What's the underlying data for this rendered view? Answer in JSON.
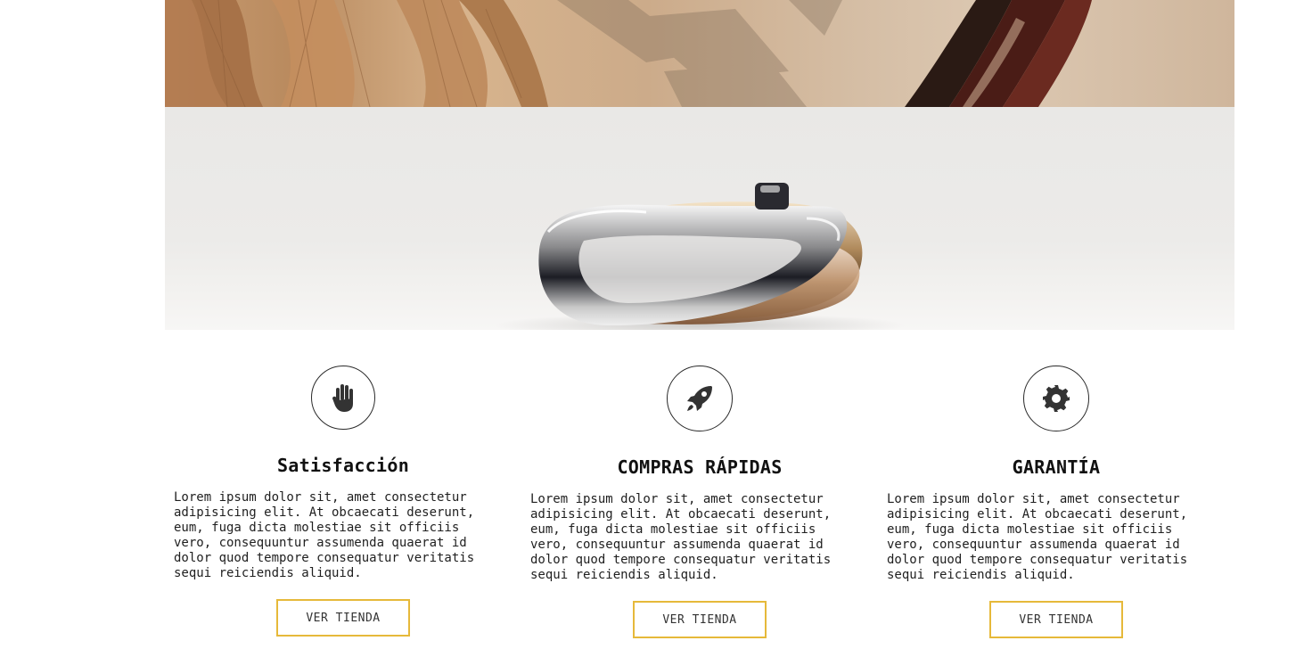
{
  "features": [
    {
      "icon": "hand-icon",
      "title": "Satisfacción",
      "body": "Lorem ipsum dolor sit, amet consectetur adipisicing elit. At obcaecati deserunt, eum, fuga dicta molestiae sit officiis vero, consequuntur assumenda quaerat id dolor quod tempore consequatur veritatis sequi reiciendis aliquid.",
      "button_label": "VER TIENDA"
    },
    {
      "icon": "rocket-icon",
      "title": "COMPRAS RÁPIDAS",
      "body": "Lorem ipsum dolor sit, amet consectetur adipisicing elit. At obcaecati deserunt, eum, fuga dicta molestiae sit officiis vero, consequuntur assumenda quaerat id dolor quod tempore consequatur veritatis sequi reiciendis aliquid.",
      "button_label": "VER TIENDA"
    },
    {
      "icon": "gear-icon",
      "title": "GARANTÍA",
      "body": "Lorem ipsum dolor sit, amet consectetur adipisicing elit. At obcaecati deserunt, eum, fuga dicta molestiae sit officiis vero, consequuntur assumenda quaerat id dolor quod tempore consequatur veritatis sequi reiciendis aliquid.",
      "button_label": "VER TIENDA"
    }
  ],
  "colors": {
    "button_border": "#e6b93a",
    "icon_fill": "#333333"
  }
}
